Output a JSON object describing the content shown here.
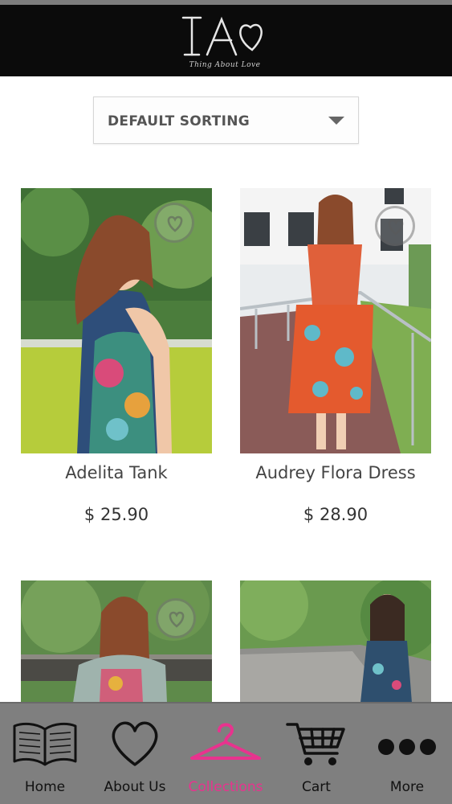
{
  "header": {
    "logo_letters": "TA♡",
    "logo_tagline": "Thing About Love"
  },
  "sort": {
    "selected": "DEFAULT SORTING"
  },
  "products": [
    {
      "name": "Adelita Tank",
      "price": "$ 25.90"
    },
    {
      "name": "Audrey Flora Dress",
      "price": "$ 28.90"
    },
    {
      "name": "",
      "price": ""
    },
    {
      "name": "",
      "price": ""
    }
  ],
  "tabs": [
    {
      "label": "Home",
      "icon": "book-icon"
    },
    {
      "label": "About Us",
      "icon": "heart-icon"
    },
    {
      "label": "Collections",
      "icon": "hanger-icon"
    },
    {
      "label": "Cart",
      "icon": "cart-icon"
    },
    {
      "label": "More",
      "icon": "more-dots-icon"
    }
  ],
  "colors": {
    "accent": "#e8338e",
    "header_bg": "#0b0b0b",
    "tabbar_bg": "#7f7f7f"
  }
}
